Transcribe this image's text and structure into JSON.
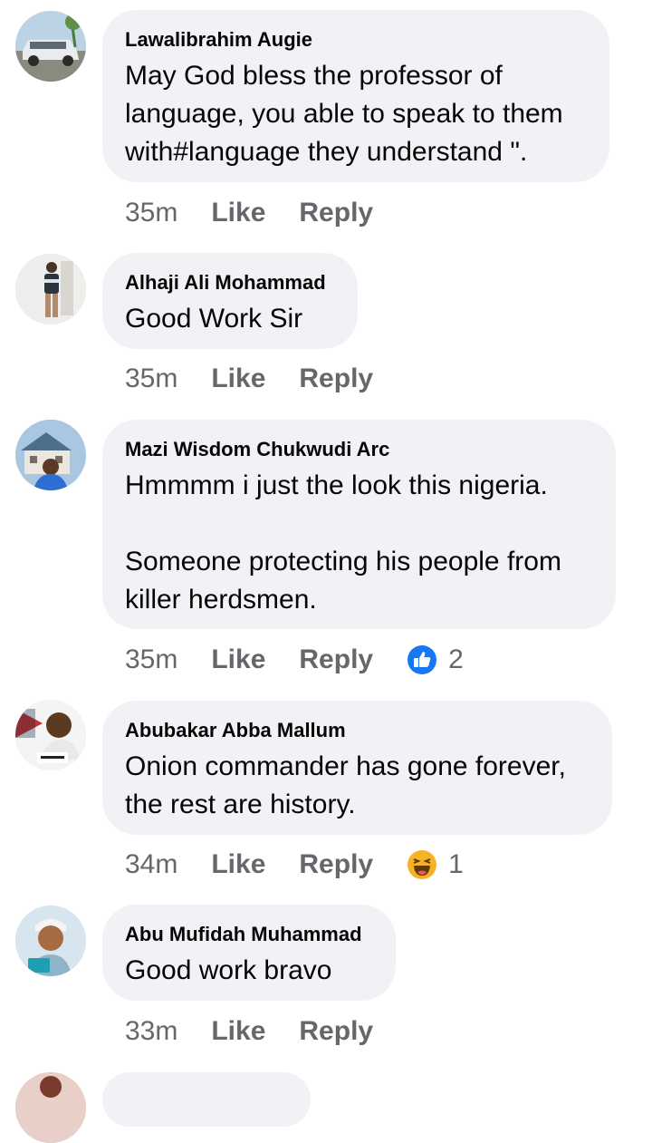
{
  "comments": [
    {
      "author": "Lawalibrahim Augie",
      "text": "May God bless the professor of language, you able to speak to them with#language they understand \".",
      "time": "35m",
      "like": "Like",
      "reply": "Reply"
    },
    {
      "author": "Alhaji Ali Mohammad",
      "text": "Good Work Sir",
      "time": "35m",
      "like": "Like",
      "reply": "Reply"
    },
    {
      "author": "Mazi Wisdom Chukwudi Arc",
      "text": "Hmmmm i just the look this nigeria.\n\nSomeone protecting his people from killer herdsmen.",
      "time": "35m",
      "like": "Like",
      "reply": "Reply",
      "reaction": {
        "icon": "like-reaction-icon",
        "count": "2",
        "color": "#1877f2"
      }
    },
    {
      "author": "Abubakar Abba Mallum",
      "text": "Onion commander has gone forever, the rest are history.",
      "time": "34m",
      "like": "Like",
      "reply": "Reply",
      "reaction": {
        "icon": "haha-reaction-icon",
        "count": "1",
        "color": "#f7b125"
      }
    },
    {
      "author": "Abu Mufidah Muhammad",
      "text": "Good work bravo",
      "time": "33m",
      "like": "Like",
      "reply": "Reply"
    }
  ]
}
